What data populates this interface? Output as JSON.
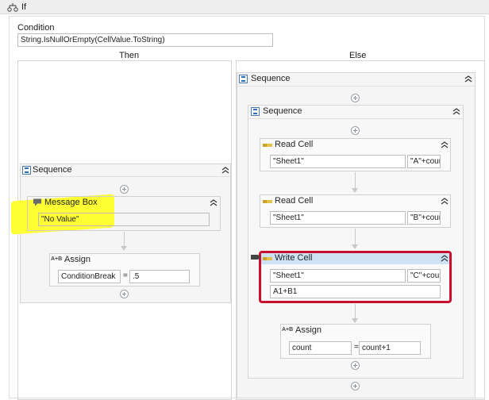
{
  "if_activity": {
    "title": "If",
    "condition_label": "Condition",
    "condition_value": "String.IsNullOrEmpty(CellValue.ToString)"
  },
  "branches": {
    "then_label": "Then",
    "else_label": "Else"
  },
  "then_sequence": {
    "title": "Sequence",
    "message_box": {
      "title": "Message Box",
      "text_value": "\"No Value\""
    },
    "assign": {
      "title": "Assign",
      "to_value": "ConditionBreak",
      "equals": "=",
      "value": ".5"
    }
  },
  "else_sequence": {
    "title": "Sequence",
    "inner_sequence": {
      "title": "Sequence",
      "read_cell_1": {
        "title": "Read Cell",
        "sheet_value": "\"Sheet1\"",
        "range_value": "\"A\"+cour"
      },
      "read_cell_2": {
        "title": "Read Cell",
        "sheet_value": "\"Sheet1\"",
        "range_value": "\"B\"+cour"
      },
      "write_cell": {
        "title": "Write Cell",
        "sheet_value": "\"Sheet1\"",
        "range_value": "\"C\"+cour",
        "value": "A1+B1"
      },
      "assign": {
        "title": "Assign",
        "to_value": "count",
        "equals": "=",
        "value": "count+1"
      }
    }
  },
  "assign_icon_text": "A+B",
  "colors": {
    "highlight": "#ffff33",
    "selected_border": "#c8102e",
    "selected_header": "#cfe2f3"
  }
}
